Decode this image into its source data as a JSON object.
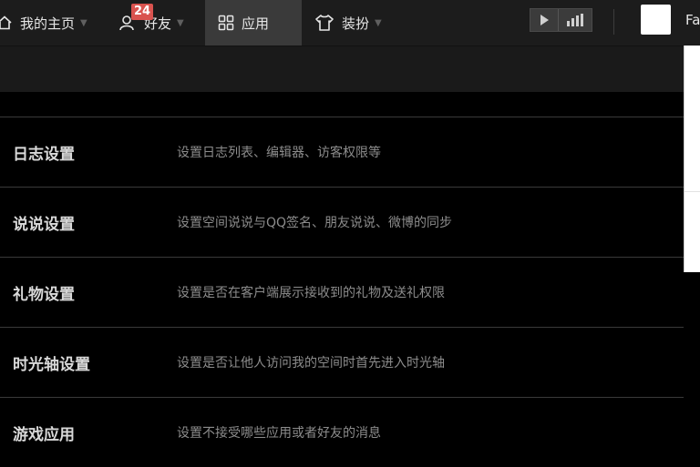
{
  "nav": {
    "items": [
      {
        "label": "我的主页",
        "icon": "home-icon"
      },
      {
        "label": "好友",
        "icon": "friends-icon",
        "badge": "24"
      },
      {
        "label": "应用",
        "icon": "apps-grid-icon",
        "active": true
      },
      {
        "label": "装扮",
        "icon": "tshirt-icon"
      }
    ],
    "user_name_partial": "Fa"
  },
  "settings": [
    {
      "title": "日志设置",
      "desc": "设置日志列表、编辑器、访客权限等"
    },
    {
      "title": "说说设置",
      "desc": "设置空间说说与QQ签名、朋友说说、微博的同步"
    },
    {
      "title": "礼物设置",
      "desc": "设置是否在客户端展示接收到的礼物及送礼权限"
    },
    {
      "title": "时光轴设置",
      "desc": "设置是否让他人访问我的空间时首先进入时光轴"
    },
    {
      "title": "游戏应用",
      "desc": "设置不接受哪些应用或者好友的消息"
    }
  ],
  "colors": {
    "accent_badge": "#d9534f",
    "background": "#000000",
    "topbar": "#1c1c1c"
  }
}
